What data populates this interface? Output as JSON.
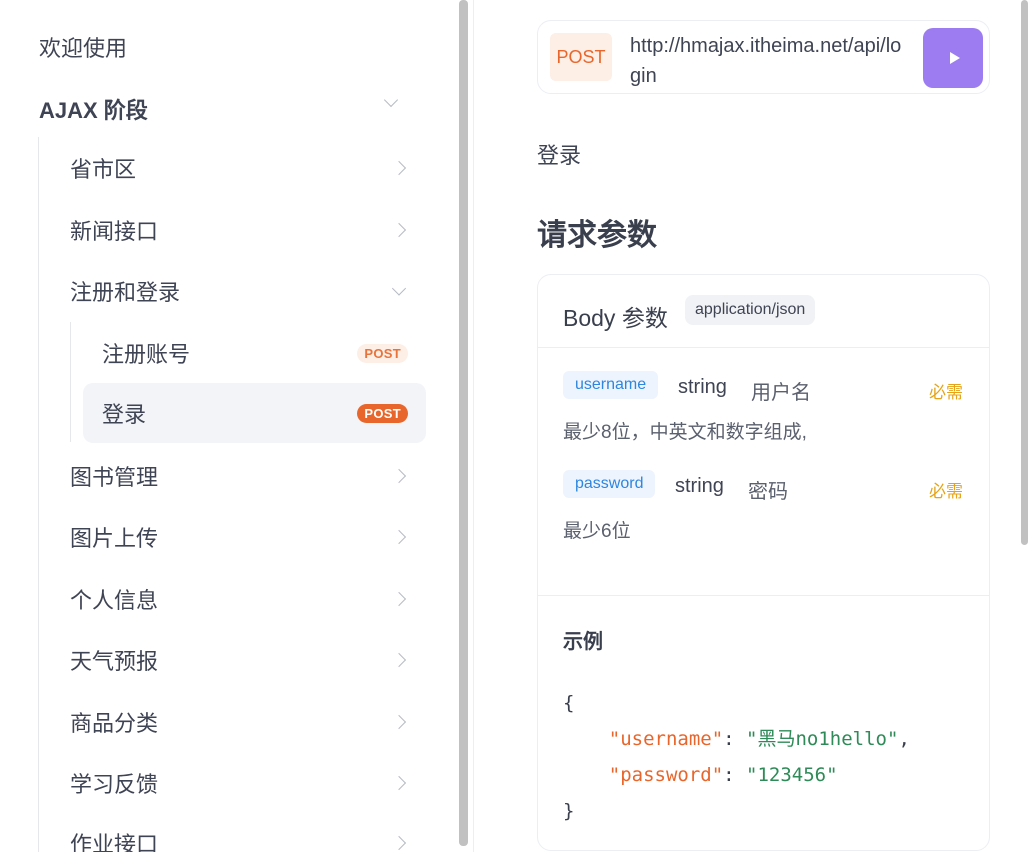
{
  "sidebar": {
    "title": "欢迎使用",
    "group": "AJAX 阶段",
    "items": [
      {
        "label": "省市区"
      },
      {
        "label": "新闻接口"
      },
      {
        "label": "注册和登录"
      },
      {
        "label": "图书管理"
      },
      {
        "label": "图片上传"
      },
      {
        "label": "个人信息"
      },
      {
        "label": "天气预报"
      },
      {
        "label": "商品分类"
      },
      {
        "label": "学习反馈"
      },
      {
        "label": "作业接口"
      }
    ],
    "sub_items": [
      {
        "label": "注册账号",
        "method": "POST"
      },
      {
        "label": "登录",
        "method": "POST"
      }
    ]
  },
  "request": {
    "method": "POST",
    "url": "http://hmajax.itheima.net/api/login"
  },
  "main": {
    "description": "登录",
    "section_title": "请求参数",
    "body_label": "Body 参数",
    "content_type": "application/json",
    "params": [
      {
        "name": "username",
        "type": "string",
        "label": "用户名",
        "required": "必需",
        "desc": "最少8位，中英文和数字组成,"
      },
      {
        "name": "password",
        "type": "string",
        "label": "密码",
        "required": "必需",
        "desc": "最少6位"
      }
    ],
    "example_title": "示例",
    "example": {
      "open": "{",
      "close": "}",
      "k1": "\"username\"",
      "v1": "\"黑马no1hello\"",
      "k2": "\"password\"",
      "v2": "\"123456\""
    }
  },
  "colors": {
    "accent": "#9c7cf0",
    "post": "#e8662b",
    "required": "#e6a317",
    "param": "#2e86de"
  }
}
